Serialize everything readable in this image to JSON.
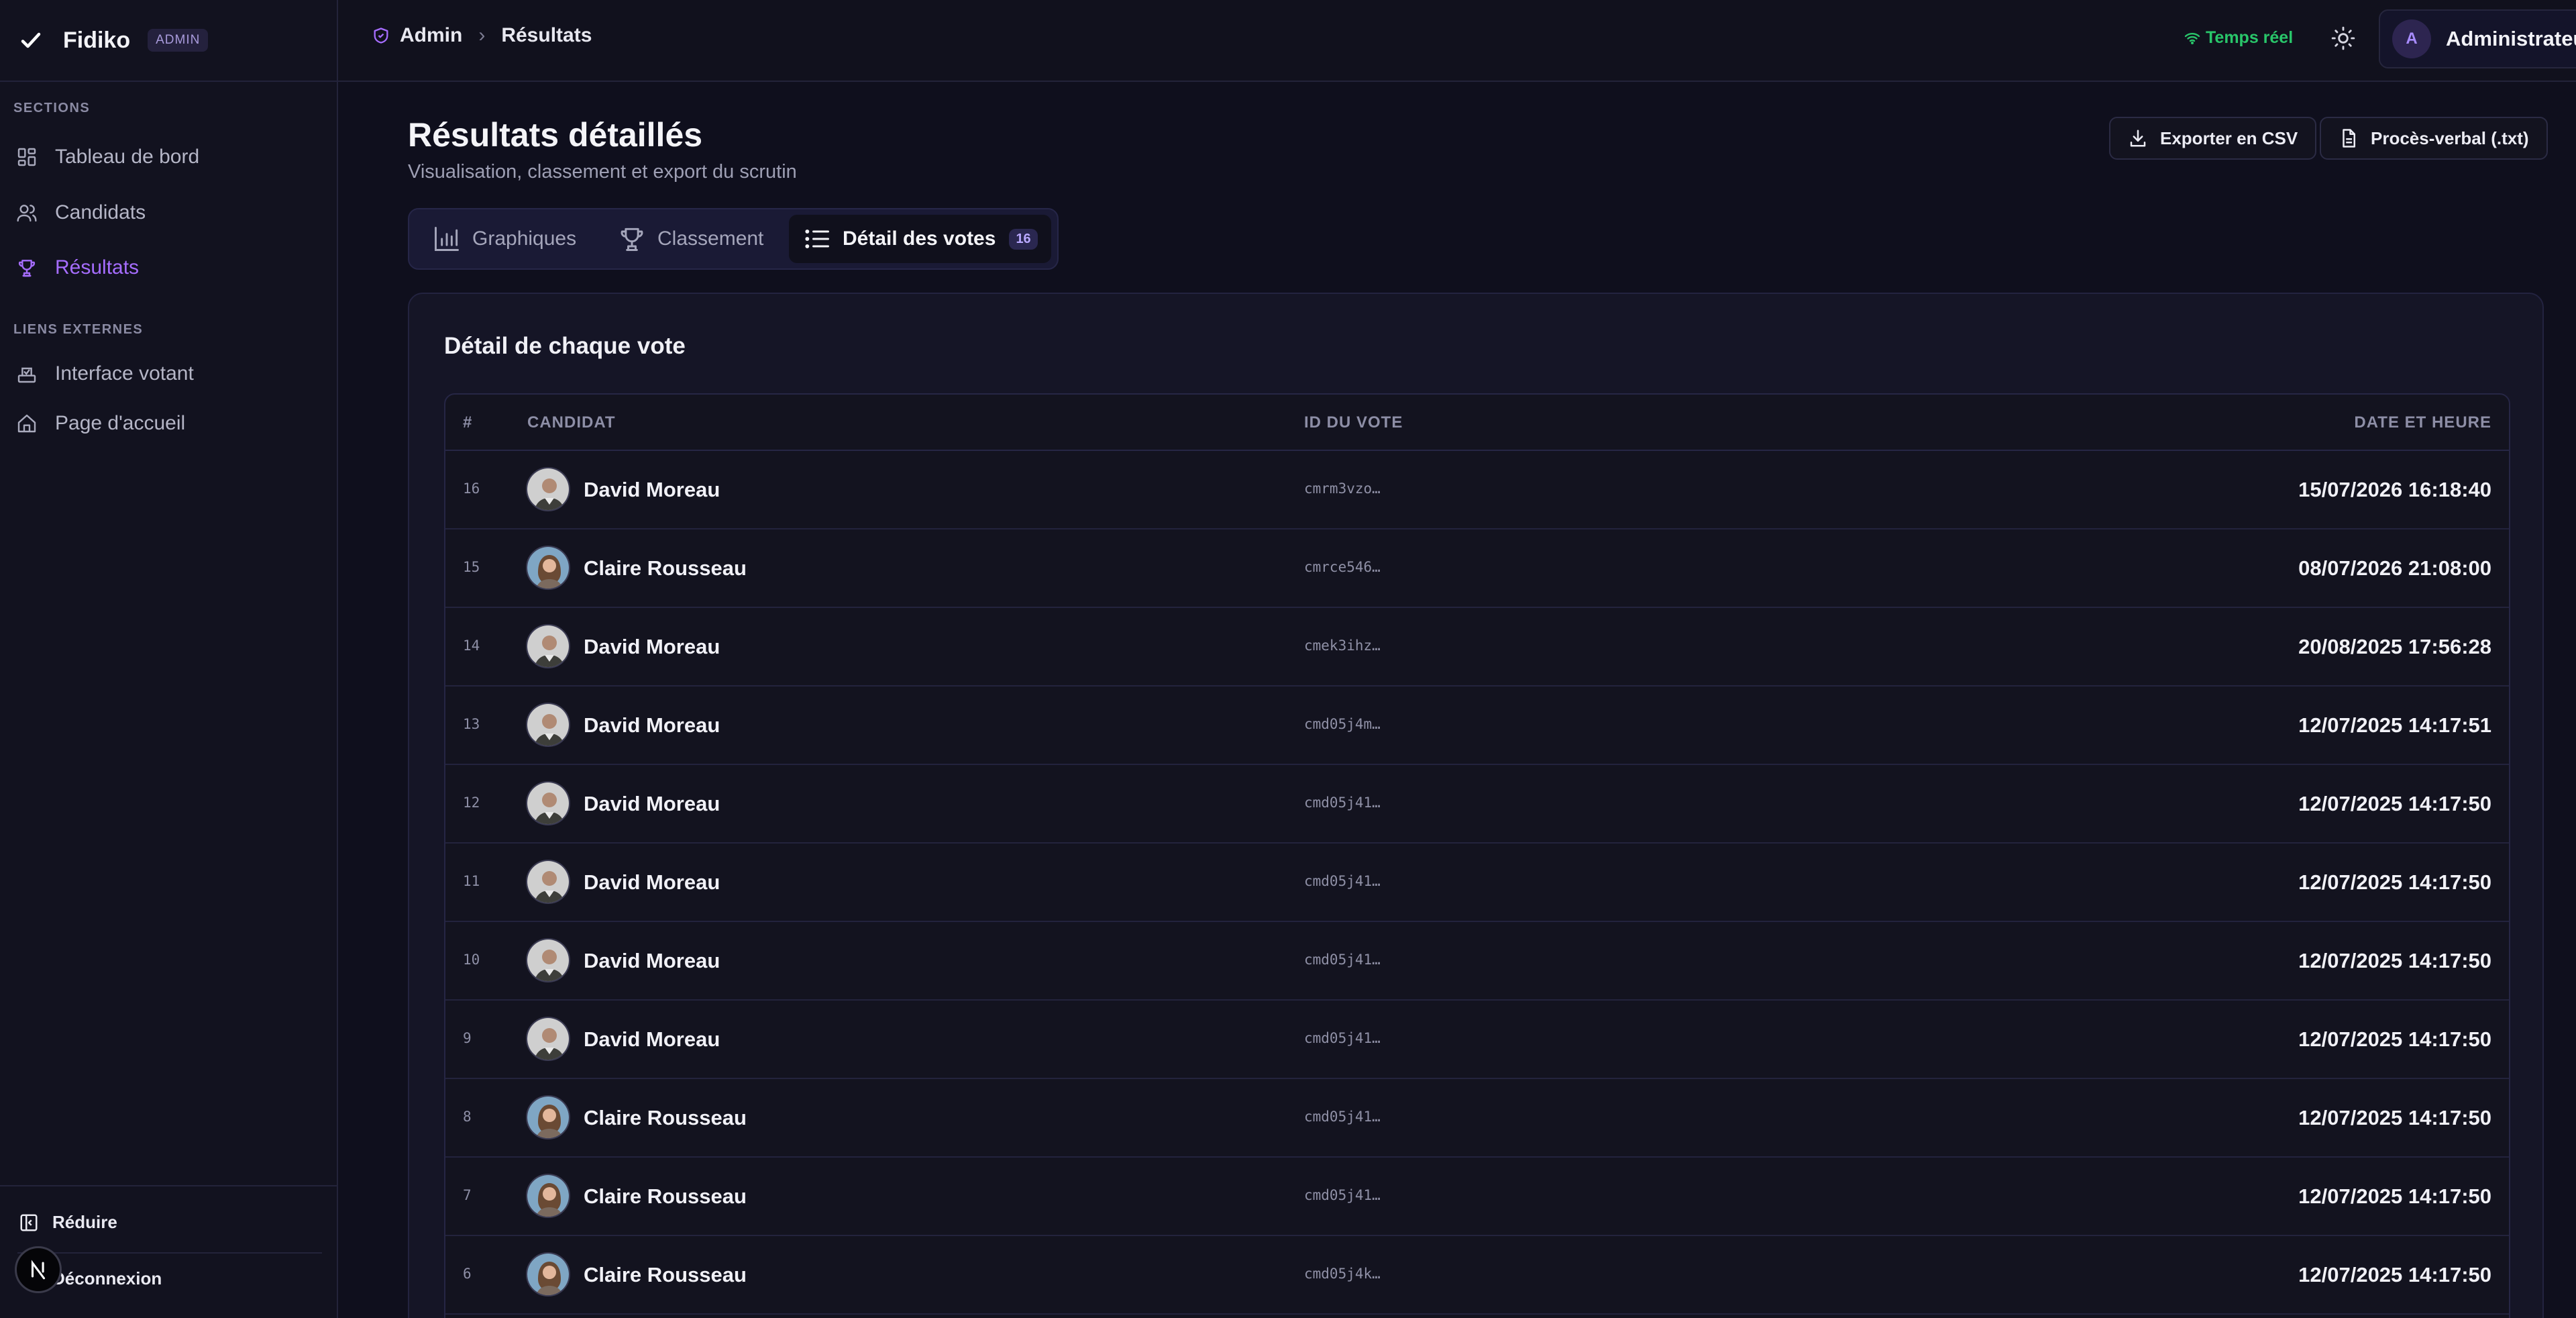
{
  "brand": {
    "name": "Fidiko",
    "badge": "ADMIN"
  },
  "sidebar": {
    "section1": "SECTIONS",
    "section2": "LIENS EXTERNES",
    "items": [
      {
        "label": "Tableau de bord",
        "icon": "dashboard-icon"
      },
      {
        "label": "Candidats",
        "icon": "users-icon"
      },
      {
        "label": "Résultats",
        "icon": "trophy-icon",
        "active": true
      },
      {
        "label": "Interface votant",
        "icon": "ballot-icon"
      },
      {
        "label": "Page d'accueil",
        "icon": "home-icon"
      }
    ],
    "collapse": "Réduire",
    "logout": "Déconnexion"
  },
  "header": {
    "crumb_root": "Admin",
    "crumb_current": "Résultats",
    "realtime": "Temps réel",
    "user_initial": "A",
    "user_name": "Administrateur"
  },
  "page": {
    "title": "Résultats détaillés",
    "subtitle": "Visualisation, classement et export du scrutin",
    "export_csv": "Exporter en CSV",
    "pv": "Procès-verbal (.txt)"
  },
  "tabs": [
    {
      "label": "Graphiques"
    },
    {
      "label": "Classement"
    },
    {
      "label": "Détail des votes",
      "count": "16"
    }
  ],
  "table": {
    "title": "Détail de chaque vote",
    "columns": {
      "num": "#",
      "candidate": "CANDIDAT",
      "vote_id": "ID DU VOTE",
      "date": "DATE ET HEURE"
    },
    "rows": [
      {
        "num": "16",
        "candidate": "David Moreau",
        "vote_id": "cmrm3vzo…",
        "date": "15/07/2026 16:18:40",
        "avatar": "man"
      },
      {
        "num": "15",
        "candidate": "Claire Rousseau",
        "vote_id": "cmrce546…",
        "date": "08/07/2026 21:08:00",
        "avatar": "woman"
      },
      {
        "num": "14",
        "candidate": "David Moreau",
        "vote_id": "cmek3ihz…",
        "date": "20/08/2025 17:56:28",
        "avatar": "man"
      },
      {
        "num": "13",
        "candidate": "David Moreau",
        "vote_id": "cmd05j4m…",
        "date": "12/07/2025 14:17:51",
        "avatar": "man"
      },
      {
        "num": "12",
        "candidate": "David Moreau",
        "vote_id": "cmd05j41…",
        "date": "12/07/2025 14:17:50",
        "avatar": "man"
      },
      {
        "num": "11",
        "candidate": "David Moreau",
        "vote_id": "cmd05j41…",
        "date": "12/07/2025 14:17:50",
        "avatar": "man"
      },
      {
        "num": "10",
        "candidate": "David Moreau",
        "vote_id": "cmd05j41…",
        "date": "12/07/2025 14:17:50",
        "avatar": "man"
      },
      {
        "num": "9",
        "candidate": "David Moreau",
        "vote_id": "cmd05j41…",
        "date": "12/07/2025 14:17:50",
        "avatar": "man"
      },
      {
        "num": "8",
        "candidate": "Claire Rousseau",
        "vote_id": "cmd05j41…",
        "date": "12/07/2025 14:17:50",
        "avatar": "woman"
      },
      {
        "num": "7",
        "candidate": "Claire Rousseau",
        "vote_id": "cmd05j41…",
        "date": "12/07/2025 14:17:50",
        "avatar": "woman"
      },
      {
        "num": "6",
        "candidate": "Claire Rousseau",
        "vote_id": "cmd05j4k…",
        "date": "12/07/2025 14:17:50",
        "avatar": "woman"
      }
    ]
  },
  "colors": {
    "accent": "#a66dff",
    "live": "#29c66a",
    "background": "#0f0f1d"
  }
}
